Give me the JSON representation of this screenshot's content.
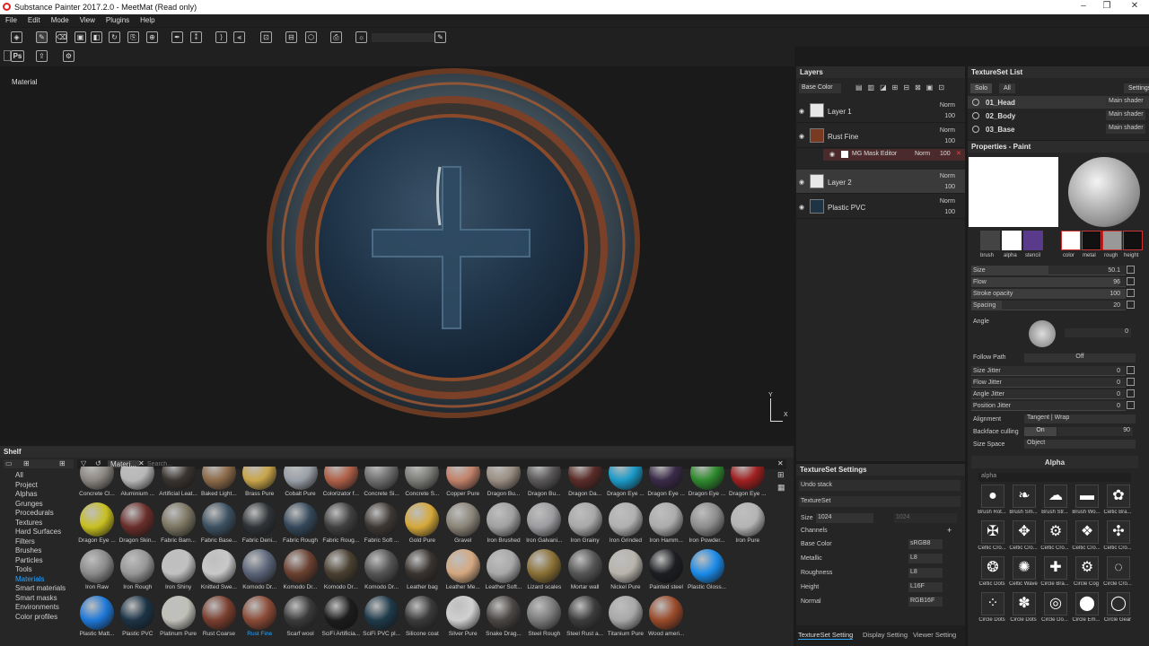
{
  "window": {
    "title": "Substance Painter 2017.2.0 - MeetMat (Read only)",
    "min": "–",
    "max": "❐",
    "close": "✕"
  },
  "menu": [
    "File",
    "Edit",
    "Mode",
    "View",
    "Plugins",
    "Help"
  ],
  "toolbar": {
    "ps_label": "Ps"
  },
  "viewport": {
    "label": "Material",
    "axis_y": "Y",
    "axis_x": "X"
  },
  "shelf": {
    "title": "Shelf",
    "filter_chip": "Materi...",
    "search_placeholder": "Search...",
    "categories": [
      "All",
      "Project",
      "Alphas",
      "Grunges",
      "Procedurals",
      "Textures",
      "Hard Surfaces",
      "Filters",
      "Brushes",
      "Particles",
      "Tools",
      "Materials",
      "Smart materials",
      "Smart masks",
      "Environments",
      "Color profiles"
    ],
    "selected_category": "Materials",
    "materials": [
      {
        "label": "Concrete Cl...",
        "color": "#8a8580"
      },
      {
        "label": "Aluminium ...",
        "color": "#b8b8b8"
      },
      {
        "label": "Artificial Leat...",
        "color": "#3a3430"
      },
      {
        "label": "Baked Light...",
        "color": "#8c6a48"
      },
      {
        "label": "Brass Pure",
        "color": "#c9a54a"
      },
      {
        "label": "Cobalt Pure",
        "color": "#9aa0a8"
      },
      {
        "label": "Colorizator f...",
        "color": "#b06048"
      },
      {
        "label": "Concrete Si...",
        "color": "#6e6e6e"
      },
      {
        "label": "Concrete S...",
        "color": "#7c7c78"
      },
      {
        "label": "Copper Pure",
        "color": "#c2826a"
      },
      {
        "label": "Dragon Bu...",
        "color": "#9a8e82"
      },
      {
        "label": "Dragon Bu...",
        "color": "#5a5858"
      },
      {
        "label": "Dragon Da...",
        "color": "#5a2c28"
      },
      {
        "label": "Dragon Eye ...",
        "color": "#1b9ac8"
      },
      {
        "label": "Dragon Eye ...",
        "color": "#3a2a48"
      },
      {
        "label": "Dragon Eye ...",
        "color": "#2e8a2e"
      },
      {
        "label": "Dragon Eye ...",
        "color": "#a02020"
      },
      {
        "label": "Dragon Eye ...",
        "color": "#c8c020"
      },
      {
        "label": "Dragon Skin...",
        "color": "#6a2e2a"
      },
      {
        "label": "Fabric Barn...",
        "color": "#7a7460"
      },
      {
        "label": "Fabric Base...",
        "color": "#3c5060"
      },
      {
        "label": "Fabric Deni...",
        "color": "#303438"
      },
      {
        "label": "Fabric Rough",
        "color": "#34485a"
      },
      {
        "label": "Fabric Roug...",
        "color": "#404040"
      },
      {
        "label": "Fabric Soft ...",
        "color": "#3e3834"
      },
      {
        "label": "Gold Pure",
        "color": "#d4a83a"
      },
      {
        "label": "Gravel",
        "color": "#8a8478"
      },
      {
        "label": "Iron Brushed",
        "color": "#a0a0a0"
      },
      {
        "label": "Iron Galvani...",
        "color": "#9c9ca0"
      },
      {
        "label": "Iron Grainy",
        "color": "#a8a8a8"
      },
      {
        "label": "Iron Grinded",
        "color": "#b0b0b0"
      },
      {
        "label": "Iron Hamm...",
        "color": "#acacac"
      },
      {
        "label": "Iron Powder...",
        "color": "#8c8c8c"
      },
      {
        "label": "Iron Pure",
        "color": "#b4b4b4"
      },
      {
        "label": "Iron Raw",
        "color": "#8a8a8a"
      },
      {
        "label": "Iron Rough",
        "color": "#969696"
      },
      {
        "label": "Iron Shiny",
        "color": "#c0c0c0"
      },
      {
        "label": "Knitted Swe...",
        "color": "#c8c8c8"
      },
      {
        "label": "Komodo Dr...",
        "color": "#5a6478"
      },
      {
        "label": "Komodo Dr...",
        "color": "#6a4030"
      },
      {
        "label": "Komodo Dr...",
        "color": "#4a4030"
      },
      {
        "label": "Komodo Dr...",
        "color": "#545454"
      },
      {
        "label": "Leather bag",
        "color": "#3a3430"
      },
      {
        "label": "Leather Me...",
        "color": "#d4a880"
      },
      {
        "label": "Leather Soft...",
        "color": "#a8a8a8"
      },
      {
        "label": "Lizard scales",
        "color": "#8a7034"
      },
      {
        "label": "Mortar wall",
        "color": "#555555"
      },
      {
        "label": "Nickel Pure",
        "color": "#b8b4ac"
      },
      {
        "label": "Painted steel",
        "color": "#1c1e22"
      },
      {
        "label": "Plastic Gloss...",
        "color": "#1a8ae8"
      },
      {
        "label": "Plastic Matt...",
        "color": "#1e78d8"
      },
      {
        "label": "Plastic PVC",
        "color": "#1c3446"
      },
      {
        "label": "Platinum Pure",
        "color": "#c0c0b8"
      },
      {
        "label": "Rust Coarse",
        "color": "#7a3e2e"
      },
      {
        "label": "Rust Fine",
        "color": "#8a4a36"
      },
      {
        "label": "Scarf wool",
        "color": "#3a3a3a"
      },
      {
        "label": "SciFi Artificia...",
        "color": "#1c1c1c"
      },
      {
        "label": "SciFi PVC pl...",
        "color": "#1e3a4a"
      },
      {
        "label": "Silicone coat",
        "color": "#3a3a3a"
      },
      {
        "label": "Silver Pure",
        "color": "#d0d0d0"
      },
      {
        "label": "Snake Drag...",
        "color": "#4a4644"
      },
      {
        "label": "Steel Rough",
        "color": "#7a7a7a"
      },
      {
        "label": "Steel Rust a...",
        "color": "#3c3c3c"
      },
      {
        "label": "Titanium Pure",
        "color": "#a8a8a8"
      },
      {
        "label": "Wood ameri...",
        "color": "#9a4a2a"
      }
    ],
    "selected_material": "Rust Fine"
  },
  "layers": {
    "title": "Layers",
    "channel": "Base Color",
    "items": [
      {
        "name": "Layer 1",
        "blend": "Norm",
        "opacity": "100",
        "thumb": "#e8e8e8"
      },
      {
        "name": "Rust Fine",
        "blend": "Norm",
        "opacity": "100",
        "thumb": "#7a3a22"
      },
      {
        "name": "Layer 2",
        "blend": "Norm",
        "opacity": "100",
        "thumb": "#e8e8e8"
      },
      {
        "name": "Plastic PVC",
        "blend": "Norm",
        "opacity": "100",
        "thumb": "#1e3444"
      }
    ],
    "mask": {
      "name": "MG Mask Editor",
      "blend": "Norm",
      "opacity": "100"
    }
  },
  "textureset_list": {
    "title": "TextureSet List",
    "solo": "Solo",
    "all": "All",
    "settings": "Settings",
    "items": [
      {
        "name": "01_Head",
        "shader": "Main shader"
      },
      {
        "name": "02_Body",
        "shader": "Main shader"
      },
      {
        "name": "03_Base",
        "shader": "Main shader"
      }
    ]
  },
  "properties": {
    "title": "Properties - Paint",
    "brush_slots": [
      "brush",
      "alpha",
      "stencil"
    ],
    "material_slots": [
      "color",
      "metal",
      "rough",
      "height"
    ],
    "size": {
      "label": "Size",
      "value": "50.1",
      "fill": 0.5
    },
    "flow": {
      "label": "Flow",
      "value": "96",
      "fill": 0.96
    },
    "stroke_opacity": {
      "label": "Stroke opacity",
      "value": "100",
      "fill": 1.0
    },
    "spacing": {
      "label": "Spacing",
      "value": "20",
      "fill": 0.2
    },
    "angle": {
      "label": "Angle",
      "value": "0"
    },
    "follow_path": {
      "label": "Follow Path",
      "value": "Off"
    },
    "size_jitter": {
      "label": "Size Jitter",
      "value": "0"
    },
    "flow_jitter": {
      "label": "Flow Jitter",
      "value": "0"
    },
    "angle_jitter": {
      "label": "Angle Jitter",
      "value": "0"
    },
    "position_jitter": {
      "label": "Position Jitter",
      "value": "0"
    },
    "alignment": {
      "label": "Alignment",
      "value": "Tangent | Wrap"
    },
    "backface": {
      "label": "Backface culling",
      "toggle": "On",
      "value": "90",
      "fill": 0.9
    },
    "size_space": {
      "label": "Size Space",
      "value": "Object"
    },
    "alpha_section": "Alpha",
    "alpha_search": "alpha",
    "alphas": [
      {
        "label": "Brush Rot...",
        "icon": "●"
      },
      {
        "label": "Brush Sm...",
        "icon": "❧"
      },
      {
        "label": "Brush Str...",
        "icon": "☁"
      },
      {
        "label": "Brush Wo...",
        "icon": "▬"
      },
      {
        "label": "Celtic Bra...",
        "icon": "✿"
      },
      {
        "label": "Celtic Cro...",
        "icon": "✠"
      },
      {
        "label": "Celtic Cro...",
        "icon": "✥"
      },
      {
        "label": "Celtic Cro...",
        "icon": "⚙"
      },
      {
        "label": "Celtic Cro...",
        "icon": "❖"
      },
      {
        "label": "Celtic Cro...",
        "icon": "✣"
      },
      {
        "label": "Celtic Dots",
        "icon": "❂"
      },
      {
        "label": "Celtic Wave",
        "icon": "✺"
      },
      {
        "label": "Circle Bra...",
        "icon": "✚"
      },
      {
        "label": "Circle Cog",
        "icon": "⚙"
      },
      {
        "label": "Circle Cro...",
        "icon": "◌"
      },
      {
        "label": "Circle Dots",
        "icon": "⁘"
      },
      {
        "label": "Circle Dots",
        "icon": "✽"
      },
      {
        "label": "Circle Do...",
        "icon": "◎"
      },
      {
        "label": "Circle Em...",
        "icon": "⬤"
      },
      {
        "label": "Circle Gear",
        "icon": "◯"
      }
    ]
  },
  "textureset_settings": {
    "title": "TextureSet Settings",
    "undo": "Undo stack",
    "textureset": "TextureSet",
    "size_label": "Size",
    "size_value": "1024",
    "size_value2": "1024",
    "channels_label": "Channels",
    "channels": [
      {
        "name": "Base Color",
        "format": "sRGB8"
      },
      {
        "name": "Metallic",
        "format": "L8"
      },
      {
        "name": "Roughness",
        "format": "L8"
      },
      {
        "name": "Height",
        "format": "L16F"
      },
      {
        "name": "Normal",
        "format": "RGB16F"
      }
    ],
    "tabs": [
      "TextureSet Setting",
      "Display Setting",
      "Viewer Setting"
    ]
  }
}
